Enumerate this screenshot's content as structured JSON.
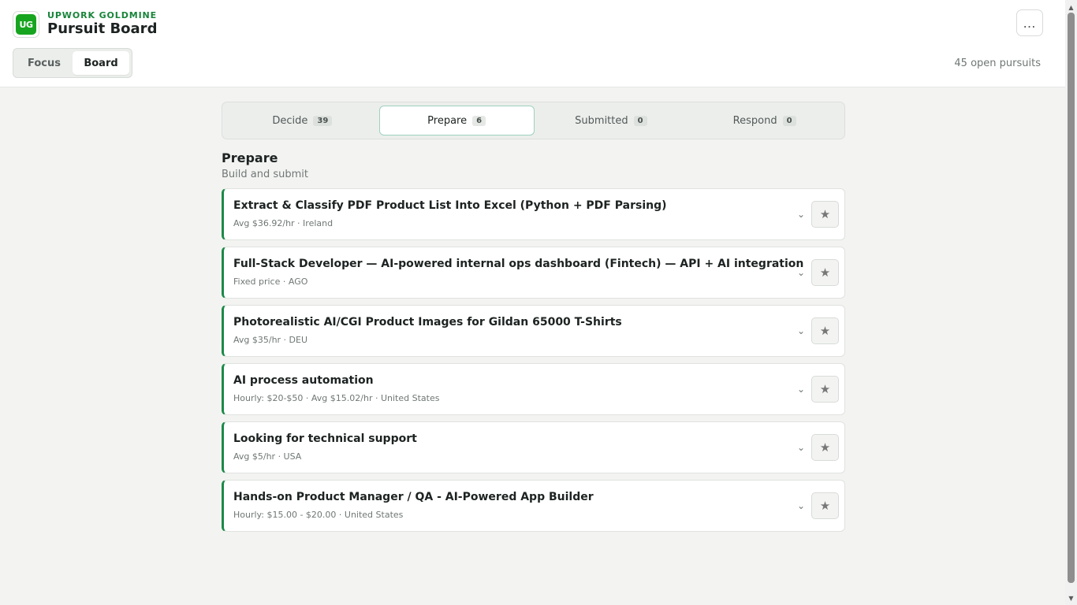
{
  "header": {
    "brand": "UPWORK GOLDMINE",
    "logo_text": "UG",
    "title": "Pursuit Board",
    "more_icon": "…",
    "view_toggle": [
      "Focus",
      "Board"
    ],
    "active_view": "Board",
    "open_count": "45 open pursuits"
  },
  "tabs": [
    {
      "label": "Decide",
      "count": "39"
    },
    {
      "label": "Prepare",
      "count": "6"
    },
    {
      "label": "Submitted",
      "count": "0"
    },
    {
      "label": "Respond",
      "count": "0"
    }
  ],
  "active_tab": "Prepare",
  "section": {
    "title": "Prepare",
    "subtitle": "Build and submit"
  },
  "cards": [
    {
      "title": "Extract & Classify PDF Product List Into Excel (Python + PDF Parsing)",
      "meta": "Avg $36.92/hr · Ireland"
    },
    {
      "title": "Full-Stack Developer — AI-powered internal ops dashboard (Fintech) — API + AI integration",
      "meta": "Fixed price · AGO"
    },
    {
      "title": "Photorealistic AI/CGI Product Images for Gildan 65000 T-Shirts",
      "meta": "Avg $35/hr · DEU"
    },
    {
      "title": "AI process automation",
      "meta": "Hourly: $20-$50 · Avg $15.02/hr · United States"
    },
    {
      "title": "Looking for technical support",
      "meta": "Avg $5/hr · USA"
    },
    {
      "title": "Hands-on Product Manager / QA - AI-Powered App Builder",
      "meta": "Hourly: $15.00 - $20.00 · United States"
    }
  ],
  "icons": {
    "chevron": "chevron-down-icon",
    "star": "star-icon",
    "accent_color": "#1b8a47"
  }
}
